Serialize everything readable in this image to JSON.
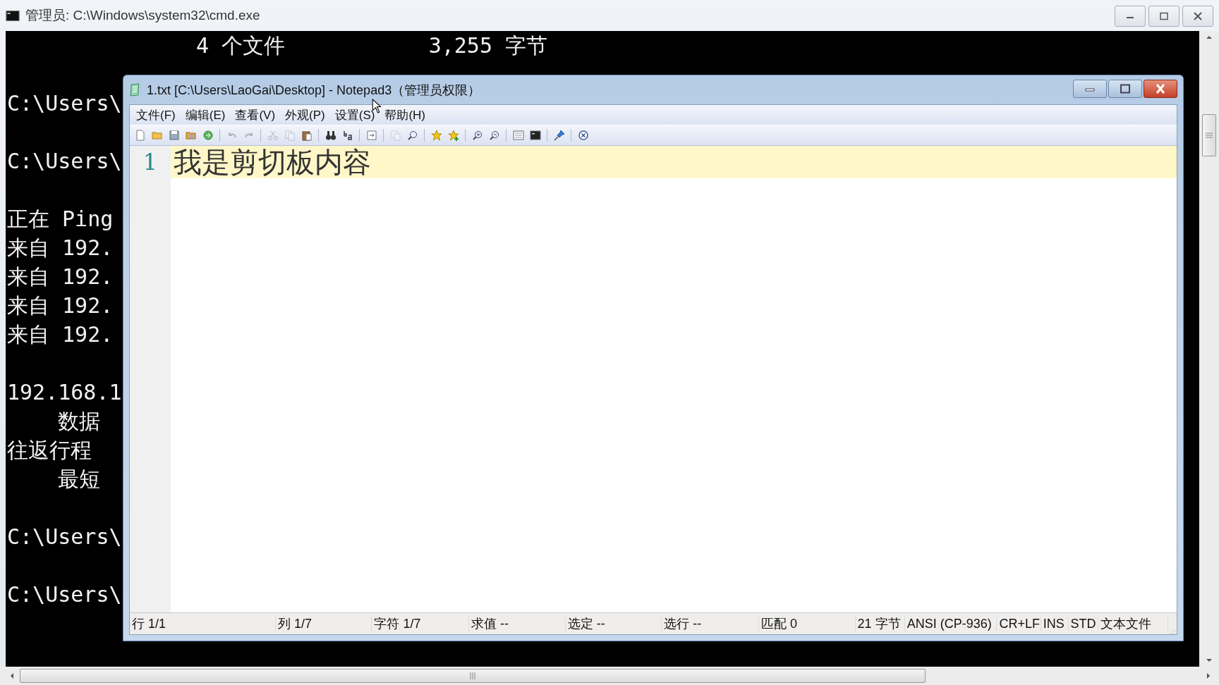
{
  "cmd_window": {
    "title": "管理员: C:\\Windows\\system32\\cmd.exe",
    "console": [
      [
        {
          "kind": "listing",
          "label": "4 个文件",
          "number": "3,255",
          "unit": "字节"
        }
      ],
      [
        {
          "kind": "plain",
          "text": "C:\\Users\\"
        }
      ],
      [
        {
          "kind": "plain",
          "text": "C:\\Users\\"
        }
      ],
      [
        {
          "kind": "plain",
          "text": "正在 Ping"
        },
        {
          "kind": "plain",
          "text": "来自 192."
        },
        {
          "kind": "plain",
          "text": "来自 192."
        },
        {
          "kind": "plain",
          "text": "来自 192."
        },
        {
          "kind": "plain",
          "text": "来自 192."
        }
      ],
      [
        {
          "kind": "plain",
          "text": "192.168.1"
        },
        {
          "kind": "indent",
          "text": "数据"
        },
        {
          "kind": "plain",
          "text": "往返行程"
        },
        {
          "kind": "indent",
          "text": "最短"
        }
      ],
      [
        {
          "kind": "plain",
          "text": "C:\\Users\\"
        }
      ],
      [
        {
          "kind": "plain",
          "text": "C:\\Users\\"
        }
      ]
    ]
  },
  "notepad_window": {
    "title": "1.txt [C:\\Users\\LaoGai\\Desktop] - Notepad3（管理员权限）",
    "menu": [
      "文件(F)",
      "编辑(E)",
      "查看(V)",
      "外观(P)",
      "设置(S)",
      "帮助(H)"
    ],
    "toolbar": [
      [
        {
          "disabled": false
        },
        {
          "disabled": false
        },
        {
          "disabled": false
        },
        {
          "disabled": false
        },
        {
          "disabled": false
        }
      ],
      [
        {
          "disabled": true
        },
        {
          "disabled": true
        }
      ],
      [
        {
          "disabled": true
        },
        {
          "disabled": true
        },
        {
          "disabled": false
        }
      ],
      [
        {
          "disabled": false
        },
        {
          "disabled": false
        }
      ],
      [
        {
          "disabled": false
        }
      ],
      [
        {
          "disabled": true
        },
        {
          "disabled": false
        }
      ],
      [
        {
          "disabled": false
        },
        {
          "disabled": false
        }
      ],
      [
        {
          "disabled": false
        },
        {
          "disabled": false
        }
      ],
      [
        {
          "disabled": false
        },
        {
          "disabled": false
        }
      ],
      [
        {
          "disabled": false
        }
      ],
      [
        {
          "disabled": false
        }
      ]
    ],
    "lines": [
      {
        "number": "1",
        "text": "我是剪切板内容",
        "current": true
      }
    ],
    "status_bar": [
      "行 1/1",
      "列 1/7",
      "字符 1/7",
      "求值 --",
      "选定 --",
      "选行 --",
      "匹配 0",
      "21 字节",
      "ANSI (CP-936)",
      "CR+LF",
      "INS",
      "STD",
      "文本文件"
    ]
  }
}
